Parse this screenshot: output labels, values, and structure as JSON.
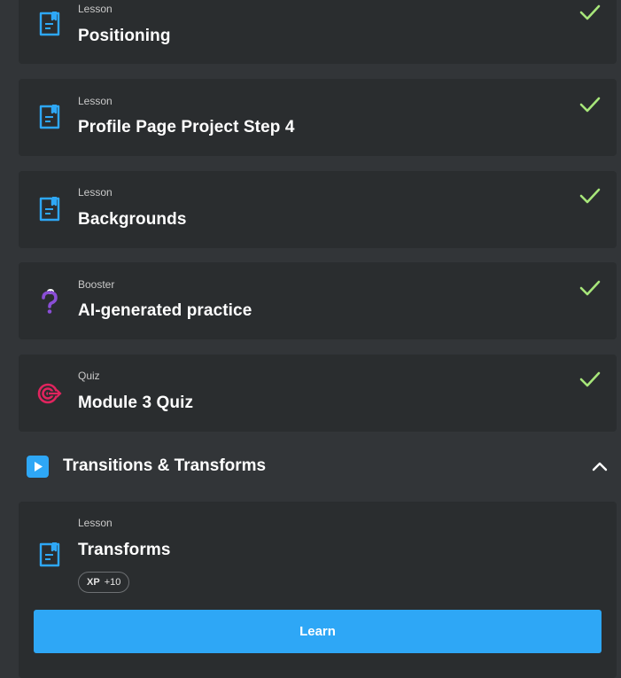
{
  "items": [
    {
      "type": "Lesson",
      "title": "Positioning",
      "icon": "lesson-icon",
      "completed": true
    },
    {
      "type": "Lesson",
      "title": "Profile Page Project Step 4",
      "icon": "lesson-icon",
      "completed": true
    },
    {
      "type": "Lesson",
      "title": "Backgrounds",
      "icon": "lesson-icon",
      "completed": true
    },
    {
      "type": "Booster",
      "title": "AI-generated practice",
      "icon": "question-mark-icon",
      "completed": true
    },
    {
      "type": "Quiz",
      "title": "Module 3 Quiz",
      "icon": "target-icon",
      "completed": true
    }
  ],
  "section": {
    "title": "Transitions & Transforms",
    "icon": "play-icon",
    "expanded": true
  },
  "current": {
    "type": "Lesson",
    "title": "Transforms",
    "icon": "lesson-icon",
    "xp_label": "XP",
    "xp_value": "+10",
    "button_label": "Learn"
  },
  "colors": {
    "page_bg": "#323538",
    "card_bg": "#2a2d2f",
    "accent_blue": "#2ea7f6",
    "check_green": "#a7e67a",
    "booster_purple": "#8a4ed6",
    "quiz_red": "#e0245e"
  }
}
